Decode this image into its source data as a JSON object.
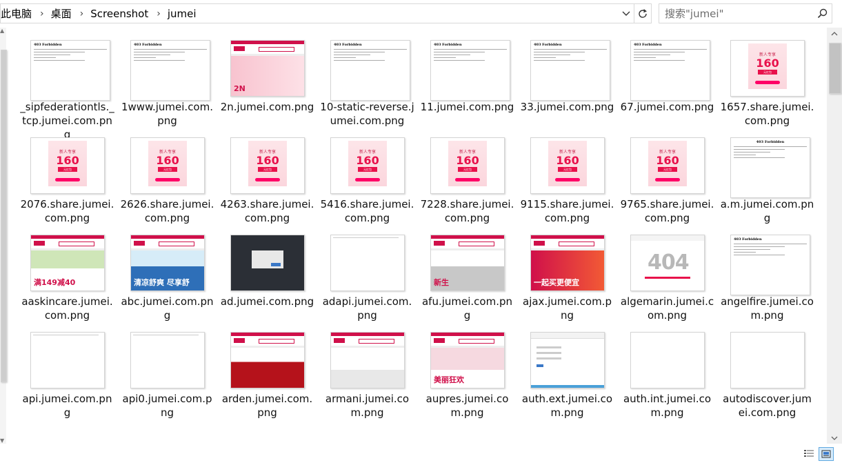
{
  "breadcrumb": {
    "items": [
      "此电脑",
      "桌面",
      "Screenshot",
      "jumei"
    ]
  },
  "search": {
    "placeholder": "搜索\"jumei\""
  },
  "files": [
    {
      "name": "_sipfederationtls._tcp.jumei.com.png",
      "thumb": "403"
    },
    {
      "name": "1www.jumei.com.png",
      "thumb": "403"
    },
    {
      "name": "2n.jumei.com.png",
      "thumb": "shop-2n",
      "banner_text": "2N"
    },
    {
      "name": "10-static-reverse.jumei.com.png",
      "thumb": "403"
    },
    {
      "name": "11.jumei.com.png",
      "thumb": "403"
    },
    {
      "name": "33.jumei.com.png",
      "thumb": "403"
    },
    {
      "name": "67.jumei.com.png",
      "thumb": "403"
    },
    {
      "name": "1657.share.jumei.com.png",
      "thumb": "pink"
    },
    {
      "name": "2076.share.jumei.com.png",
      "thumb": "pink"
    },
    {
      "name": "2626.share.jumei.com.png",
      "thumb": "pink"
    },
    {
      "name": "4263.share.jumei.com.png",
      "thumb": "pink"
    },
    {
      "name": "5416.share.jumei.com.png",
      "thumb": "pink"
    },
    {
      "name": "7228.share.jumei.com.png",
      "thumb": "pink"
    },
    {
      "name": "9115.share.jumei.com.png",
      "thumb": "pink"
    },
    {
      "name": "9765.share.jumei.com.png",
      "thumb": "pink"
    },
    {
      "name": "a.m.jumei.com.png",
      "thumb": "403c"
    },
    {
      "name": "aaskincare.jumei.com.png",
      "thumb": "shop-aa",
      "banner_text": "满149减40"
    },
    {
      "name": "abc.jumei.com.png",
      "thumb": "shop-abc",
      "banner_text": "清凉舒爽 尽享舒"
    },
    {
      "name": "ad.jumei.com.png",
      "thumb": "dark"
    },
    {
      "name": "adapi.jumei.com.png",
      "thumb": "tiny"
    },
    {
      "name": "afu.jumei.com.png",
      "thumb": "shop-afu",
      "banner_text": "新生"
    },
    {
      "name": "ajax.jumei.com.png",
      "thumb": "shop-ajax",
      "banner_text": "一起买更便宜"
    },
    {
      "name": "algemarin.jumei.com.png",
      "thumb": "404",
      "banner_text": "404"
    },
    {
      "name": "angelfire.jumei.com.png",
      "thumb": "403"
    },
    {
      "name": "api.jumei.com.png",
      "thumb": "tiny"
    },
    {
      "name": "api0.jumei.com.png",
      "thumb": "tiny"
    },
    {
      "name": "arden.jumei.com.png",
      "thumb": "shop-arden"
    },
    {
      "name": "armani.jumei.com.png",
      "thumb": "shop-armani"
    },
    {
      "name": "aupres.jumei.com.png",
      "thumb": "shop-aupres",
      "banner_text": "美丽狂欢"
    },
    {
      "name": "auth.ext.jumei.com.png",
      "thumb": "auth"
    },
    {
      "name": "auth.int.jumei.com.png",
      "thumb": "blank"
    },
    {
      "name": "autodiscover.jumei.com.png",
      "thumb": "blank"
    }
  ],
  "thumb_text": {
    "forbidden": "403 Forbidden",
    "promo_line": "新人专享",
    "promo_amount": "160",
    "promo_unit": "元红包"
  },
  "colors": {
    "brand": "#d0104a",
    "pink": "#e8114b",
    "selection": "#5fa8e0"
  },
  "statusbar": {
    "view_details_icon": "details-view-icon",
    "view_icons_icon": "large-icons-view-icon"
  }
}
